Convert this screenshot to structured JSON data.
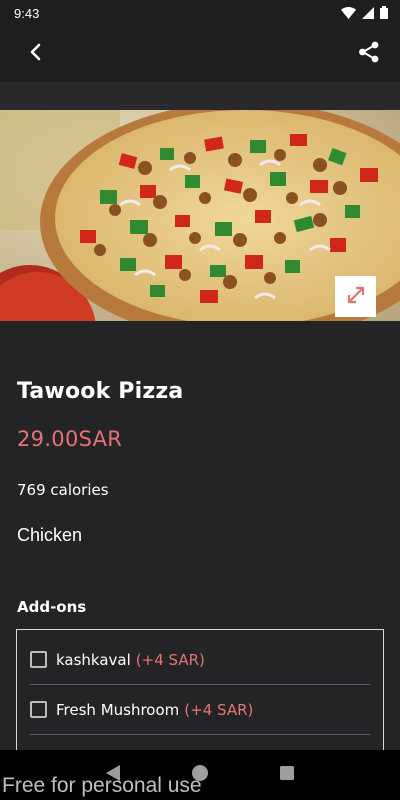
{
  "status_bar": {
    "time": "9:43",
    "icons": [
      "wifi-icon",
      "signal-icon",
      "battery-icon"
    ]
  },
  "app_bar": {
    "back_icon": "back-arrow-icon",
    "share_icon": "share-icon"
  },
  "hero": {
    "image": "pizza-photo",
    "expand_icon": "expand-icon"
  },
  "item": {
    "name": "Tawook Pizza",
    "price": "29.00SAR",
    "calories": "769 calories",
    "category": "Chicken"
  },
  "addons": {
    "heading": "Add-ons",
    "items": [
      {
        "label": "kashkaval",
        "price": "(+4 SAR)",
        "checked": false
      },
      {
        "label": "Fresh Mushroom",
        "price": "(+4 SAR)",
        "checked": false
      }
    ]
  },
  "nav_bar": {
    "icons": [
      "back-triangle-icon",
      "home-circle-icon",
      "recents-square-icon"
    ]
  },
  "watermark": "Free for personal use",
  "colors": {
    "background": "#242427",
    "accent_price": "#e57373",
    "bar": "#1e1e21"
  }
}
